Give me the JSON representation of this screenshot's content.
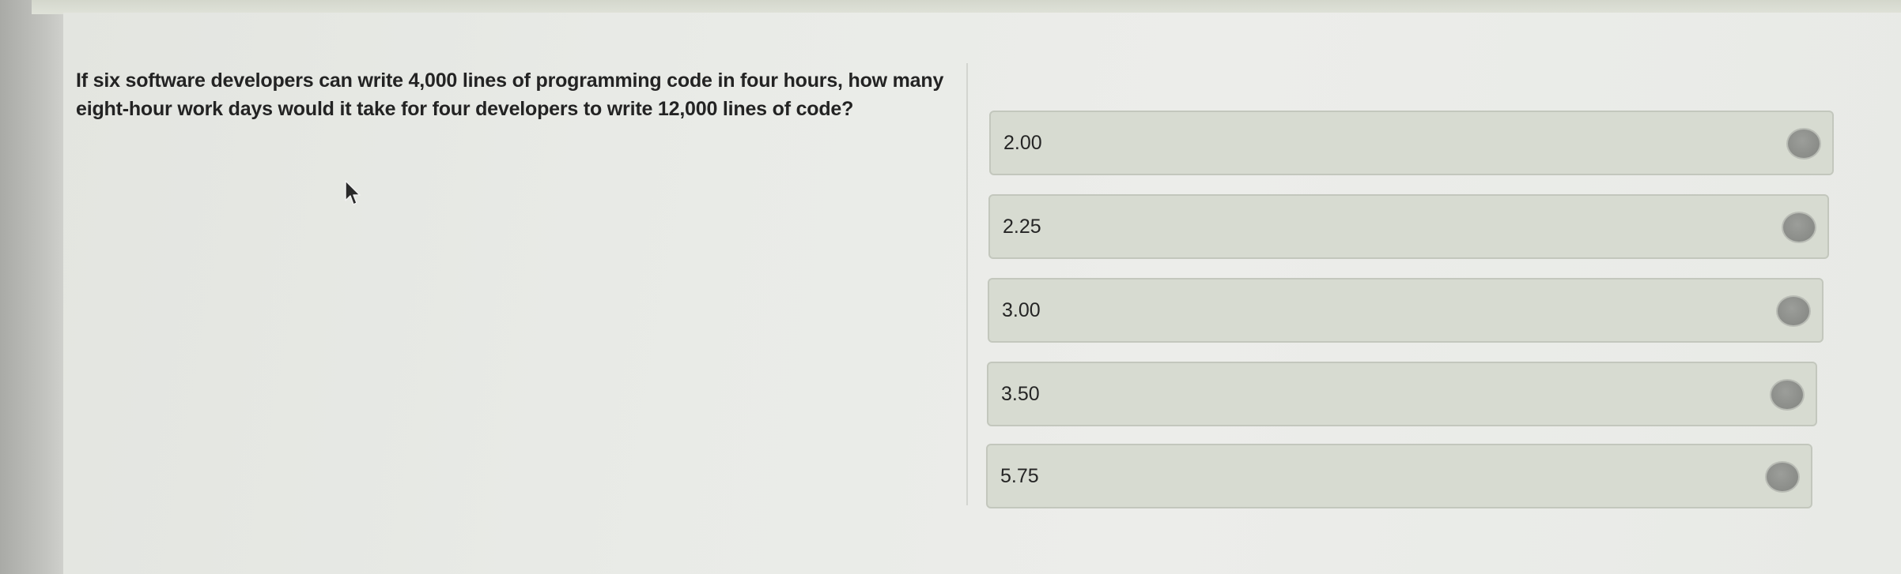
{
  "question": {
    "text": "If six software developers can write 4,000 lines of programming code in four hours, how many eight-hour work days would it take for four developers to write 12,000 lines of code?"
  },
  "options": [
    {
      "label": "2.00"
    },
    {
      "label": "2.25"
    },
    {
      "label": "3.00"
    },
    {
      "label": "3.50"
    },
    {
      "label": "5.75"
    }
  ],
  "icons": {
    "cursor": "mouse-pointer-icon",
    "radio": "radio-button-icon"
  }
}
